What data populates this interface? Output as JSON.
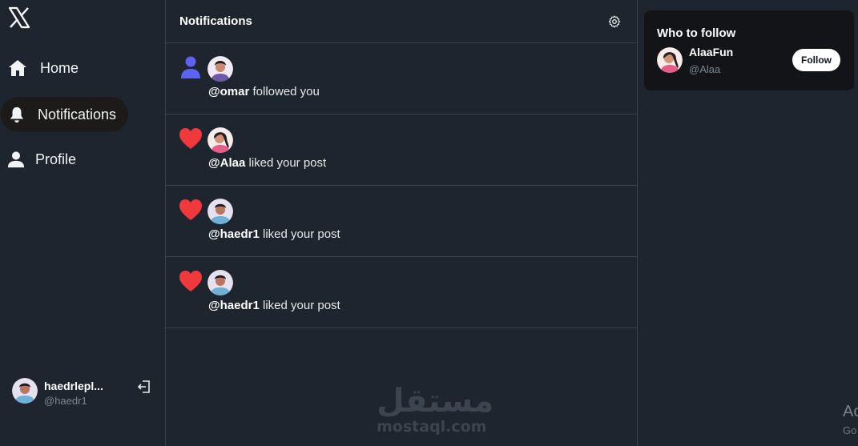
{
  "colors": {
    "background": "#1e252e",
    "border": "#3a4450",
    "active_nav_bg": "#1c1b1a",
    "heart": "#f0393d",
    "follow_icon": "#5b63f0",
    "card_bg": "#121417"
  },
  "sidebar": {
    "logo_icon": "x-logo-icon",
    "items": [
      {
        "label": "Home",
        "icon": "home-icon"
      },
      {
        "label": "Notifications",
        "icon": "bell-icon",
        "active": true
      },
      {
        "label": "Profile",
        "icon": "user-icon"
      }
    ],
    "account": {
      "name": "haedrlepl...",
      "handle": "@haedr1",
      "logout_icon": "logout-icon"
    }
  },
  "main": {
    "title": "Notifications",
    "settings_icon": "gear-icon",
    "notifications": [
      {
        "type": "follow",
        "icon": "person-icon",
        "user": "@omar",
        "text": " followed you"
      },
      {
        "type": "like",
        "icon": "heart-icon",
        "user": "@Alaa",
        "text": " liked your post"
      },
      {
        "type": "like",
        "icon": "heart-icon",
        "user": "@haedr1",
        "text": " liked your post"
      },
      {
        "type": "like",
        "icon": "heart-icon",
        "user": "@haedr1",
        "text": " liked your post"
      }
    ]
  },
  "who_to_follow": {
    "title": "Who to follow",
    "suggestions": [
      {
        "name": "AlaaFun",
        "handle": "@Alaa",
        "button": "Follow"
      }
    ]
  },
  "watermark": {
    "arabic": "مستقل",
    "latin": "mostaql.com"
  },
  "os_overlay": {
    "line1": "Ac",
    "line2": "Go"
  }
}
